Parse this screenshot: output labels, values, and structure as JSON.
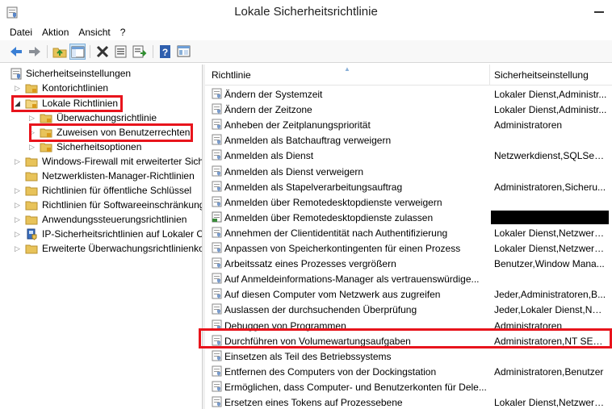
{
  "window": {
    "title": "Lokale Sicherheitsrichtlinie"
  },
  "menu": [
    "Datei",
    "Aktion",
    "Ansicht",
    "?"
  ],
  "toolbar": {
    "buttons": [
      "back-arrow-icon",
      "forward-arrow-icon",
      "up-folder-icon",
      "show-hide-tree-icon",
      "delete-icon",
      "properties-icon",
      "export-list-icon",
      "help-icon",
      "console-icon"
    ]
  },
  "tree": {
    "root": "Sicherheitseinstellungen",
    "items": [
      {
        "label": "Kontorichtlinien"
      },
      {
        "label": "Lokale Richtlinien"
      },
      {
        "label": "Überwachungsrichtlinie"
      },
      {
        "label": "Zuweisen von Benutzerrechten"
      },
      {
        "label": "Sicherheitsoptionen"
      },
      {
        "label": "Windows-Firewall mit erweiterter Sich"
      },
      {
        "label": "Netzwerklisten-Manager-Richtlinien"
      },
      {
        "label": "Richtlinien für öffentliche Schlüssel"
      },
      {
        "label": "Richtlinien für Softwareeinschränkung"
      },
      {
        "label": "Anwendungssteuerungsrichtlinien"
      },
      {
        "label": "IP-Sicherheitsrichtlinien auf Lokaler C"
      },
      {
        "label": "Erweiterte Überwachungsrichtlinienko"
      }
    ]
  },
  "list": {
    "columns": [
      "Richtlinie",
      "Sicherheitseinstellung"
    ],
    "rows": [
      {
        "name": "Ändern der Systemzeit",
        "setting": "Lokaler Dienst,Administr..."
      },
      {
        "name": "Ändern der Zeitzone",
        "setting": "Lokaler Dienst,Administr..."
      },
      {
        "name": "Anheben der Zeitplanungspriorität",
        "setting": "Administratoren"
      },
      {
        "name": "Anmelden als Batchauftrag verweigern",
        "setting": ""
      },
      {
        "name": "Anmelden als Dienst",
        "setting": "Netzwerkdienst,SQLServ..."
      },
      {
        "name": "Anmelden als Dienst verweigern",
        "setting": ""
      },
      {
        "name": "Anmelden als Stapelverarbeitungsauftrag",
        "setting": "Administratoren,Sicheru..."
      },
      {
        "name": "Anmelden über Remotedesktopdienste verweigern",
        "setting": ""
      },
      {
        "name": "Anmelden über Remotedesktopdienste zulassen",
        "setting": ""
      },
      {
        "name": "Annehmen der Clientidentität nach Authentifizierung",
        "setting": "Lokaler Dienst,Netzwerk..."
      },
      {
        "name": "Anpassen von Speicherkontingenten für einen Prozess",
        "setting": "Lokaler Dienst,Netzwerk..."
      },
      {
        "name": "Arbeitssatz eines Prozesses vergrößern",
        "setting": "Benutzer,Window Mana..."
      },
      {
        "name": "Auf Anmeldeinformations-Manager als vertrauenswürdige...",
        "setting": ""
      },
      {
        "name": "Auf diesen Computer vom Netzwerk aus zugreifen",
        "setting": "Jeder,Administratoren,B..."
      },
      {
        "name": "Auslassen der durchsuchenden Überprüfung",
        "setting": "Jeder,Lokaler Dienst,Net..."
      },
      {
        "name": "Debuggen von Programmen",
        "setting": "Administratoren"
      },
      {
        "name": "Durchführen von Volumewartungsaufgaben",
        "setting": "Administratoren,NT SER..."
      },
      {
        "name": "Einsetzen als Teil des Betriebssystems",
        "setting": ""
      },
      {
        "name": "Entfernen des Computers von der Dockingstation",
        "setting": "Administratoren,Benutzer"
      },
      {
        "name": "Ermöglichen, dass Computer- und Benutzerkonten für Dele...",
        "setting": ""
      },
      {
        "name": "Ersetzen eines Tokens auf Prozessebene",
        "setting": "Lokaler Dienst,Netzwerk..."
      }
    ]
  },
  "colors": {
    "highlight": "#e8141c",
    "folder": "#e8c35a",
    "selected_toolbar": "#cce4f7"
  }
}
